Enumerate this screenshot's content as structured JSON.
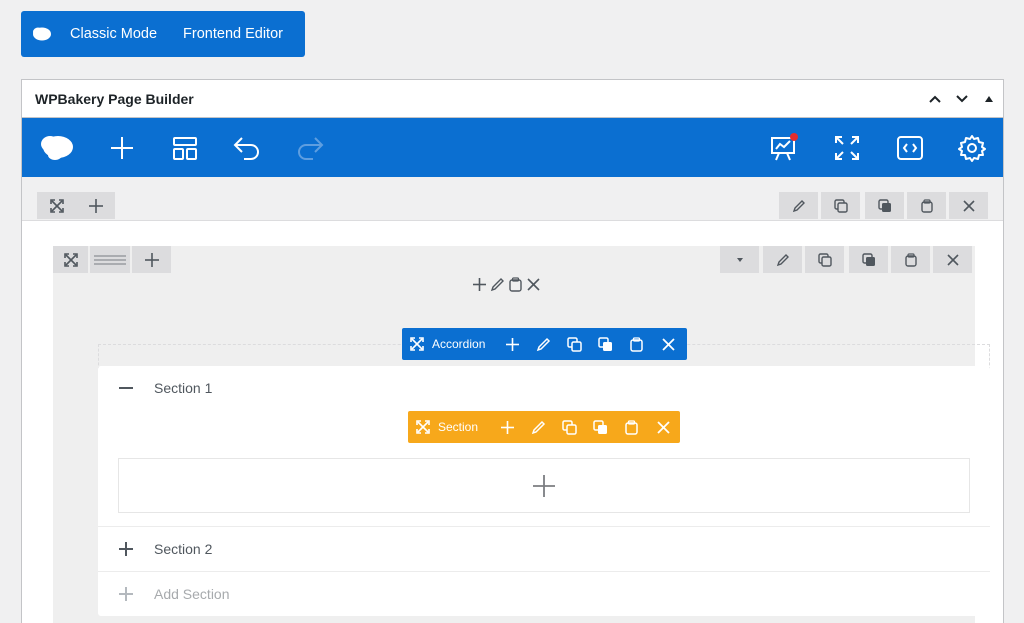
{
  "mode_bar": {
    "classic_mode": "Classic Mode",
    "frontend_editor": "Frontend Editor"
  },
  "postbox": {
    "title": "WPBakery Page Builder"
  },
  "accordion_toolbar": {
    "label": "Accordion"
  },
  "section_toolbar": {
    "label": "Section"
  },
  "accordion": {
    "sections": [
      {
        "label": "Section 1",
        "state": "expanded"
      },
      {
        "label": "Section 2",
        "state": "collapsed"
      }
    ],
    "add_section": "Add Section"
  },
  "colors": {
    "brand_blue": "#0b6fd1",
    "section_orange": "#f7a81b",
    "notification_red": "#e32d2d"
  }
}
